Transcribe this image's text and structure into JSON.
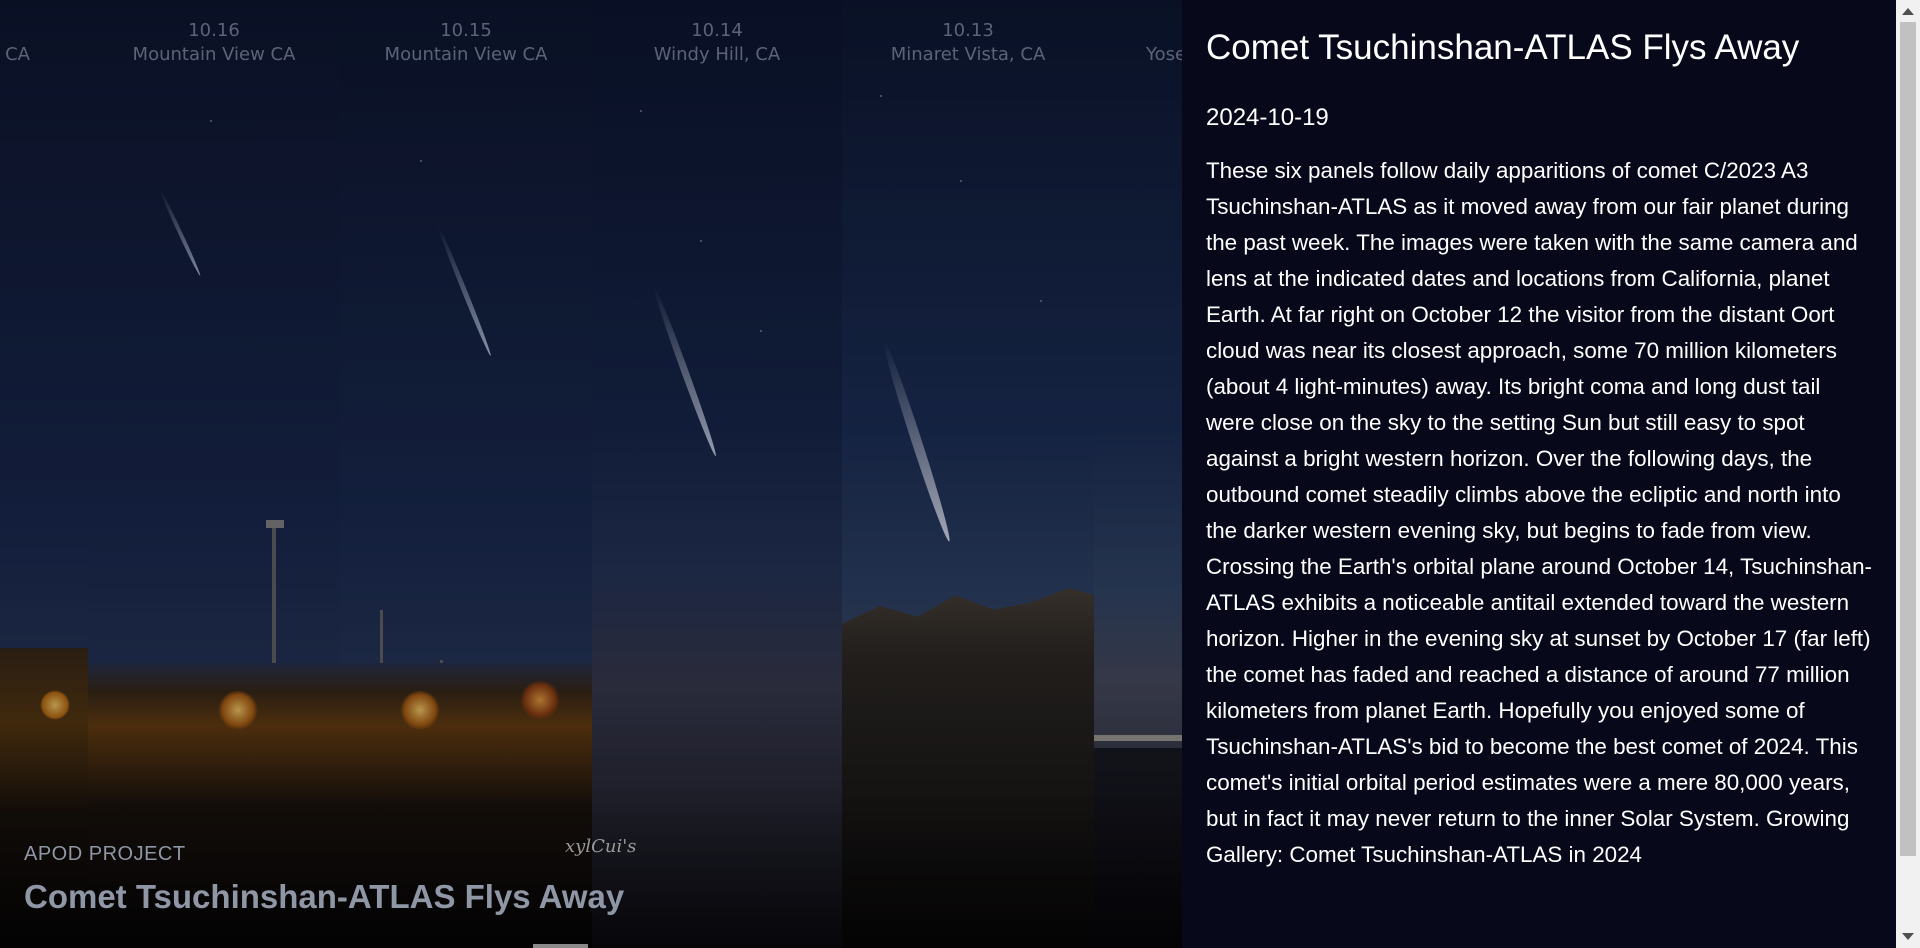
{
  "image": {
    "panels": [
      {
        "date": "",
        "location": "CA"
      },
      {
        "date": "10.16",
        "location": "Mountain View CA"
      },
      {
        "date": "10.15",
        "location": "Mountain View CA"
      },
      {
        "date": "10.14",
        "location": "Windy Hill, CA"
      },
      {
        "date": "10.13",
        "location": "Minaret Vista, CA"
      },
      {
        "date": "",
        "location": "Yose"
      }
    ],
    "signature": "xylCui's",
    "project_label": "APOD PROJECT",
    "overlay_title": "Comet Tsuchinshan-ATLAS Flys Away"
  },
  "info": {
    "title": "Comet Tsuchinshan-ATLAS Flys Away",
    "date": "2024-10-19",
    "explanation": "These six panels follow daily apparitions of comet C/2023 A3 Tsuchinshan-ATLAS as it moved away from our fair planet during the past week. The images were taken with the same camera and lens at the indicated dates and locations from California, planet Earth. At far right on October 12 the visitor from the distant Oort cloud was near its closest approach, some 70 million kilometers (about 4 light-minutes) away. Its bright coma and long dust tail were close on the sky to the setting Sun but still easy to spot against a bright western horizon. Over the following days, the outbound comet steadily climbs above the ecliptic and north into the darker western evening sky, but begins to fade from view. Crossing the Earth's orbital plane around October 14, Tsuchinshan-ATLAS exhibits a noticeable antitail extended toward the western horizon. Higher in the evening sky at sunset by October 17 (far left) the comet has faded and reached a distance of around 77 million kilometers from planet Earth. Hopefully you enjoyed some of Tsuchinshan-ATLAS's bid to become the best comet of 2024. This comet's initial orbital period estimates were a mere 80,000 years, but in fact it may never return to the inner Solar System.",
    "gallery_link": "Growing Gallery: Comet Tsuchinshan-ATLAS in 2024"
  },
  "colors": {
    "info_background": "#07091a",
    "text": "#ffffff",
    "overlay_text": "#8f96a6"
  }
}
